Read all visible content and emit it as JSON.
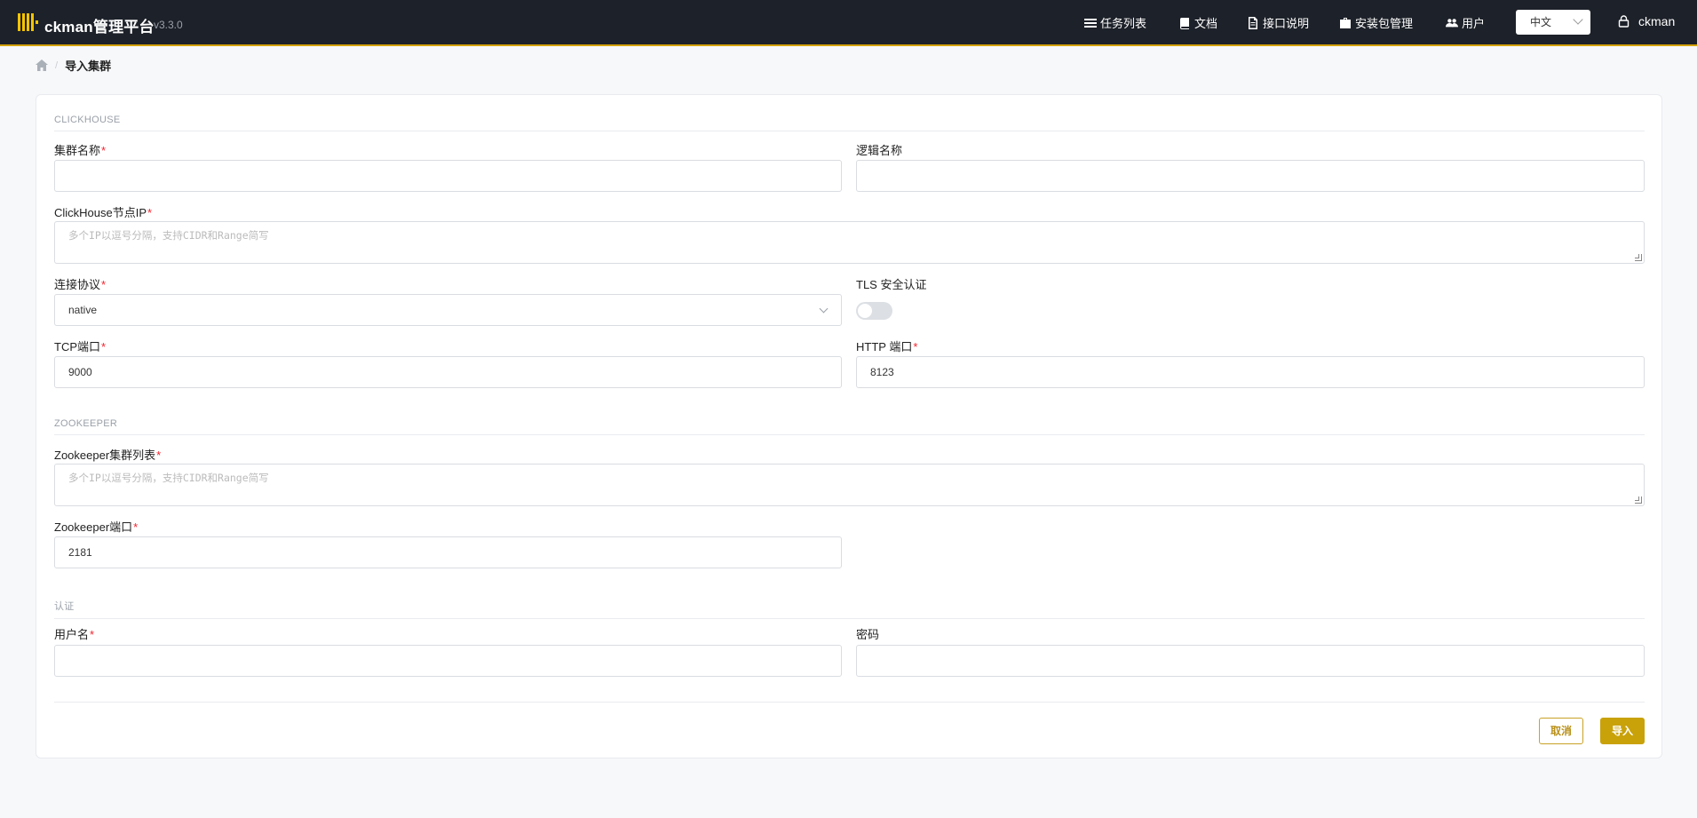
{
  "header": {
    "brand": "ckman管理平台",
    "version": "v3.3.0",
    "nav": [
      {
        "label": "任务列表",
        "icon": "list-icon"
      },
      {
        "label": "文档",
        "icon": "book-icon"
      },
      {
        "label": "接口说明",
        "icon": "file-icon"
      },
      {
        "label": "安装包管理",
        "icon": "briefcase-icon"
      },
      {
        "label": "用户",
        "icon": "users-icon"
      }
    ],
    "language": "中文",
    "username": "ckman"
  },
  "breadcrumb": {
    "current": "导入集群"
  },
  "form": {
    "clickhouse_section": "CLICKHOUSE",
    "cluster_name_label": "集群名称",
    "cluster_name_value": "",
    "logic_name_label": "逻辑名称",
    "logic_name_value": "",
    "ch_nodes_label": "ClickHouse节点IP",
    "ch_nodes_placeholder": "多个IP以逗号分隔，支持CIDR和Range简写",
    "protocol_label": "连接协议",
    "protocol_value": "native",
    "tls_label": "TLS 安全认证",
    "tls_enabled": false,
    "tcp_port_label": "TCP端口",
    "tcp_port_value": "9000",
    "http_port_label": "HTTP 端口",
    "http_port_value": "8123",
    "zookeeper_section": "ZOOKEEPER",
    "zk_nodes_label": "Zookeeper集群列表",
    "zk_nodes_placeholder": "多个IP以逗号分隔，支持CIDR和Range简写",
    "zk_port_label": "Zookeeper端口",
    "zk_port_value": "2181",
    "auth_section": "认证",
    "username_label": "用户名",
    "username_value": "",
    "password_label": "密码",
    "password_value": "",
    "required_mark": "*"
  },
  "actions": {
    "cancel": "取消",
    "import": "导入"
  }
}
